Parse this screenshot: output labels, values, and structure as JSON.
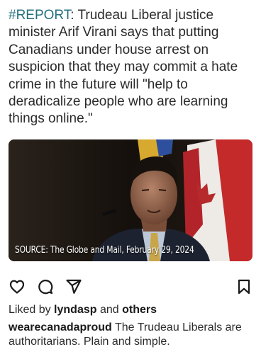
{
  "post": {
    "hashtag": "#REPORT",
    "body": ": Trudeau Liberal justice minister Arif Virani says that putting Canadians under house arrest on suspicion that they may commit a hate crime in the future will \"help to deradicalize people who are learning things online.\""
  },
  "media": {
    "caption": "SOURCE: The Globe and Mail, February 29, 2024"
  },
  "actions": {
    "like_icon": "heart-outline",
    "comment_icon": "speech-bubble-outline",
    "share_icon": "paper-plane-outline",
    "save_icon": "bookmark-outline"
  },
  "likes": {
    "prefix": "Liked by ",
    "user": "lyndasp",
    "middle": " and ",
    "others": "others"
  },
  "comment": {
    "username": "wearecanadaproud",
    "text": " The Trudeau Liberals are authoritarians. Plain and simple."
  },
  "colors": {
    "hashtag": "#25707e",
    "text": "#2a2a2a"
  }
}
